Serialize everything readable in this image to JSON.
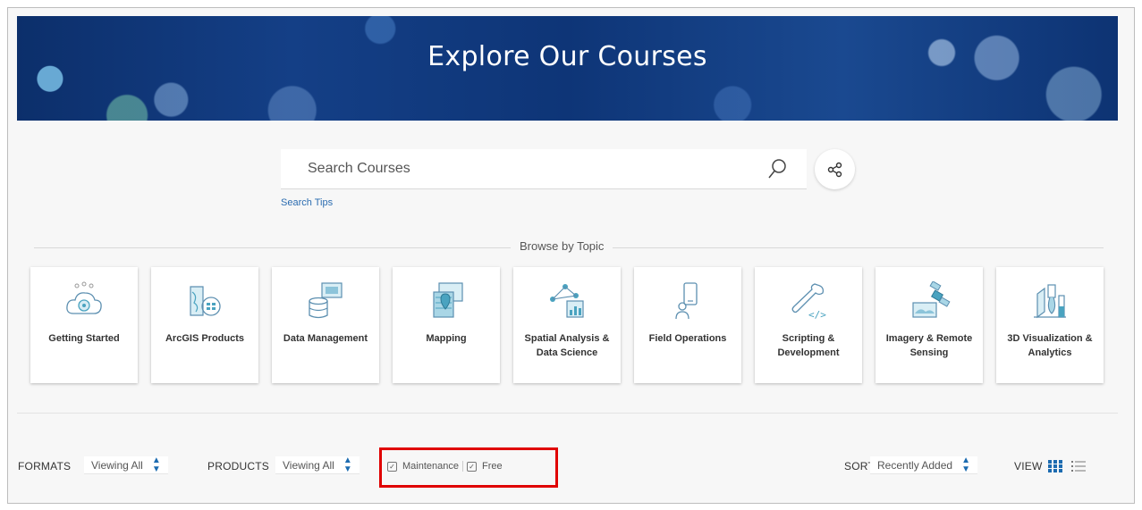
{
  "hero": {
    "title": "Explore Our Courses"
  },
  "search": {
    "placeholder": "Search Courses",
    "tips_label": "Search Tips"
  },
  "browse": {
    "label": "Browse by Topic"
  },
  "topics": [
    {
      "label": "Getting Started",
      "icon": "cloud-gear-icon"
    },
    {
      "label": "ArcGIS Products",
      "icon": "map-apps-icon"
    },
    {
      "label": "Data Management",
      "icon": "database-icon"
    },
    {
      "label": "Mapping",
      "icon": "map-pin-icon"
    },
    {
      "label": "Spatial Analysis & Data Science",
      "icon": "network-chart-icon"
    },
    {
      "label": "Field Operations",
      "icon": "mobile-device-icon"
    },
    {
      "label": "Scripting & Development",
      "icon": "wrench-code-icon"
    },
    {
      "label": "Imagery & Remote Sensing",
      "icon": "satellite-icon"
    },
    {
      "label": "3D Visualization & Analytics",
      "icon": "3d-chart-icon"
    }
  ],
  "filters": {
    "formats_label": "FORMATS",
    "formats_value": "Viewing All",
    "products_label": "PRODUCTS",
    "products_value": "Viewing All",
    "maintenance_label": "Maintenance",
    "free_label": "Free",
    "sort_label": "SORT",
    "sort_value": "Recently Added",
    "view_label": "VIEW"
  },
  "colors": {
    "accent": "#1c6bb0",
    "highlight": "#e00000",
    "banner": "#143f86"
  }
}
